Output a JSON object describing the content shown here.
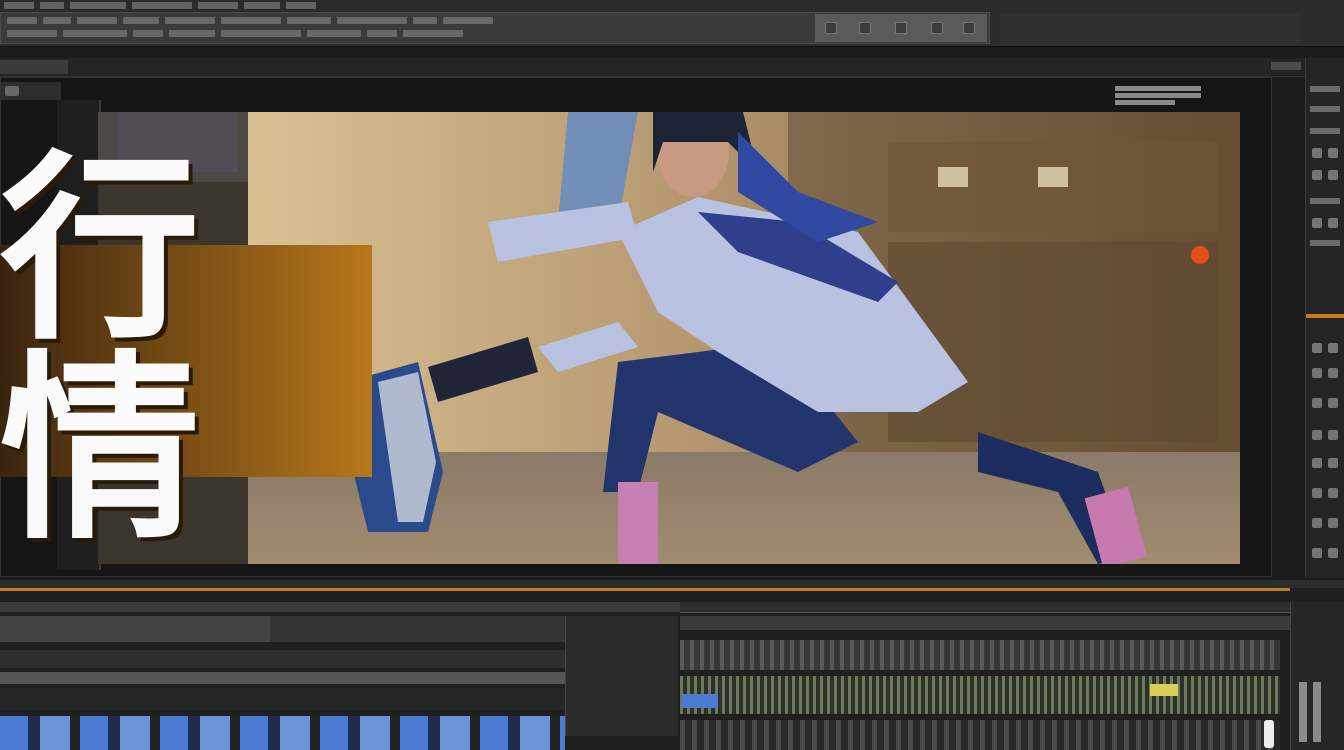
{
  "viewer": {
    "overlay_text": "行情"
  },
  "colors": {
    "accent_orange": "#c77a1b",
    "panel_bg": "#1b1b1b",
    "title_card": "#b8771a",
    "clip_blue": "#4b7bd3"
  },
  "icons": [
    "settings-icon",
    "play-icon",
    "marker-icon",
    "lock-icon",
    "eye-icon",
    "close-icon"
  ]
}
